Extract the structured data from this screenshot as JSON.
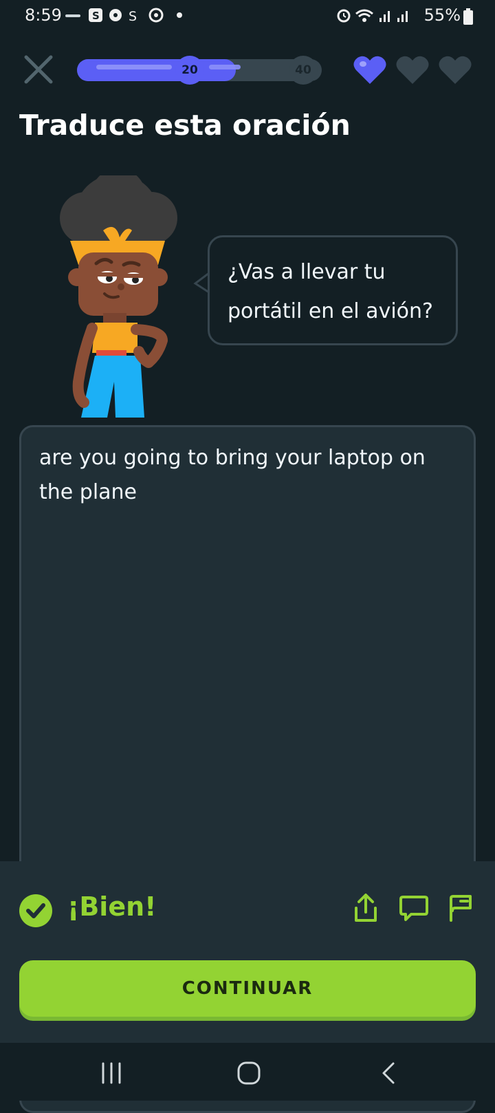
{
  "status_bar": {
    "time": "8:59",
    "battery": "55%",
    "left_icons": [
      "coursera-icon",
      "s-app-icon",
      "gear-app-icon",
      "s-loop-icon",
      "target-app-icon",
      "dot-icon"
    ],
    "right_icons": [
      "alarm-icon",
      "wifi-icon",
      "signal-icon",
      "signal-icon",
      "battery-icon"
    ]
  },
  "header": {
    "progress_label_current": "20",
    "progress_label_goal": "40",
    "progress_fraction": 0.65,
    "hearts_filled": 1,
    "hearts_total": 3
  },
  "title": "Traduce esta oración",
  "prompt": {
    "text": "¿Vas a llevar tu portátil en el avión?"
  },
  "answer": {
    "text": "are you going to bring your laptop on the plane"
  },
  "feedback": {
    "text": "¡Bien!",
    "status": "correct",
    "actions": [
      "share-icon",
      "comment-icon",
      "report-flag-icon"
    ]
  },
  "continue_label": "CONTINUAR",
  "colors": {
    "background": "#131f24",
    "accent_blue": "#5b5ff5",
    "success_green": "#93d333",
    "panel": "#202f36",
    "border": "#37464f"
  }
}
